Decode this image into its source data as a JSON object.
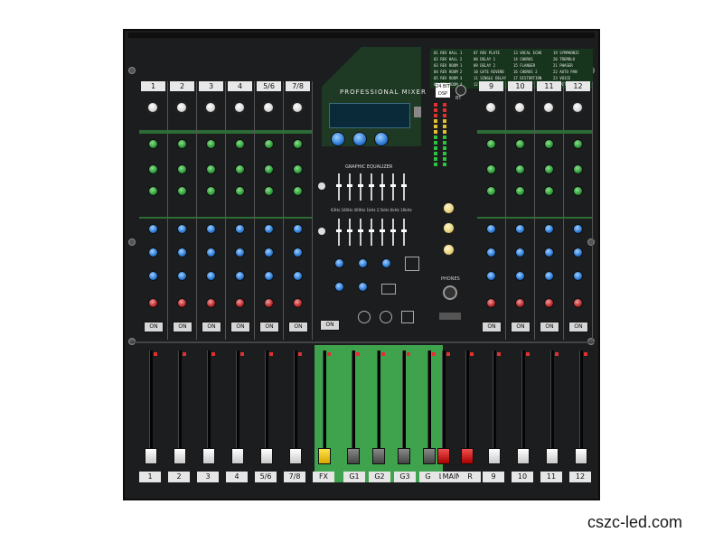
{
  "mixer": {
    "brand_title": "PROFESSIONAL MIXER",
    "eq_title": "GRAPHIC EQUALIZER",
    "eq_bands": "63Hz 160Hz 400Hz 1kHz 2.5kHz 6kHz 16kHz",
    "phones_label": "PHONES",
    "fx_badge": "24 BIT DSP",
    "bt_label": "BT",
    "top_channels": [
      "1",
      "2",
      "3",
      "4",
      "5/6",
      "7/8",
      "9",
      "10",
      "11",
      "12"
    ],
    "on_label": "ON",
    "bottom_channels": [
      "1",
      "2",
      "3",
      "4",
      "5/6",
      "7/8",
      "FX",
      "G1",
      "G2",
      "G3",
      "G4",
      "L",
      "MAIN",
      "R",
      "9",
      "10",
      "11",
      "12"
    ],
    "presets": [
      "01 REV HALL 1",
      "02 REV HALL 2",
      "03 REV ROOM 1",
      "04 REV ROOM 2",
      "05 REV ROOM 3",
      "06 REV ROOM 4",
      "07 REV PLATE",
      "08 DELAY 1",
      "09 DELAY 2",
      "10 GATE REVERB",
      "11 SINGLE DELAY",
      "12 ECHO",
      "13 VOCAL ECHO",
      "14 CHORUS",
      "15 FLANGER",
      "16 CHORUS 2",
      "17 DISTORTION",
      "18 ROTARY",
      "19 SYMPHONIC",
      "20 TREMOLO",
      "21 PHASER",
      "22 AUTO PAN",
      "23 VOICE",
      "24 PITCH SHIFT"
    ]
  },
  "watermark": "cszc-led.com",
  "colors": {
    "body": "#1c1d1f",
    "band_green": "#2d6b36",
    "fader_green": "#3fa34d",
    "accent_red": "#b8262a"
  }
}
